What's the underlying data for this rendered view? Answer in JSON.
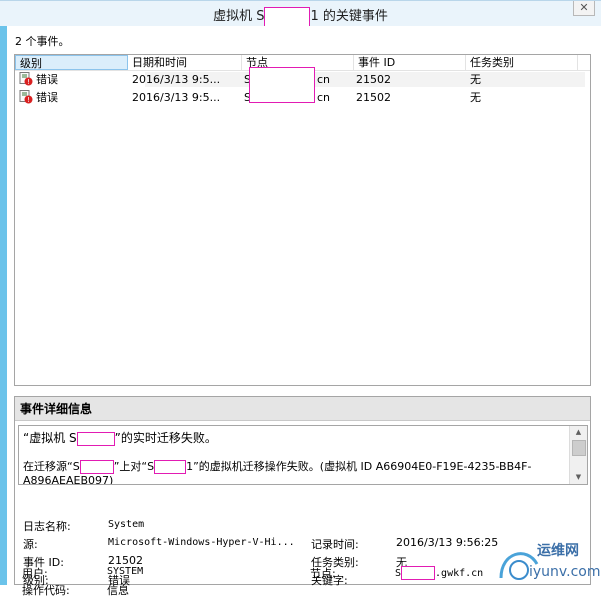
{
  "window": {
    "title_prefix": "虚拟机 S",
    "title_suffix": "1 的关键事件",
    "close_glyph": "✕"
  },
  "events_count": "2 个事件。",
  "columns": [
    "级别",
    "日期和时间",
    "节点",
    "事件 ID",
    "任务类别"
  ],
  "events": [
    {
      "level": "错误",
      "datetime": "2016/3/13 9:5...",
      "node_prefix": "S",
      "node_suffix": "cn",
      "event_id": "21502",
      "task_category": "无"
    },
    {
      "level": "错误",
      "datetime": "2016/3/13 9:5...",
      "node_prefix": "S",
      "node_suffix": "cn",
      "event_id": "21502",
      "task_category": "无"
    }
  ],
  "details": {
    "header": "事件详细信息",
    "line1_prefix": "“虚拟机 S",
    "line1_suffix": "”的实时迁移失败。",
    "line2_a": "在迁移源“S",
    "line2_b": "”上对“S",
    "line2_c": "1”的虚拟机迁移操作失败。(虚拟机 ID A66904E0-F19E-4235-BB4F-",
    "line3": "A896AEAEB097)"
  },
  "properties": {
    "log_name_label": "日志名称:",
    "log_name_value": "System",
    "source_label": "源:",
    "source_value": "Microsoft-Windows-Hyper-V-Hi...",
    "logged_label": "记录时间:",
    "logged_value": "2016/3/13 9:56:25",
    "event_id_label": "事件 ID:",
    "event_id_value": "21502",
    "task_label": "任务类别:",
    "task_value": "无",
    "level_label": "级别:",
    "level_value": "错误",
    "keywords_label": "关键字:",
    "user_label": "用户:",
    "user_value": "SYSTEM",
    "node_label": "节点:",
    "node_prefix": "S",
    "node_suffix": ".gwkf.cn",
    "opcode_label": "操作代码:",
    "opcode_value": "信息"
  },
  "watermark": {
    "brand": "运维网",
    "url": "iyunv.com"
  },
  "colors": {
    "redaction": "#e21bb3",
    "title_bar": "#eaf4fb",
    "window_edge": "#6bc3ea",
    "error_red": "#d92020"
  }
}
